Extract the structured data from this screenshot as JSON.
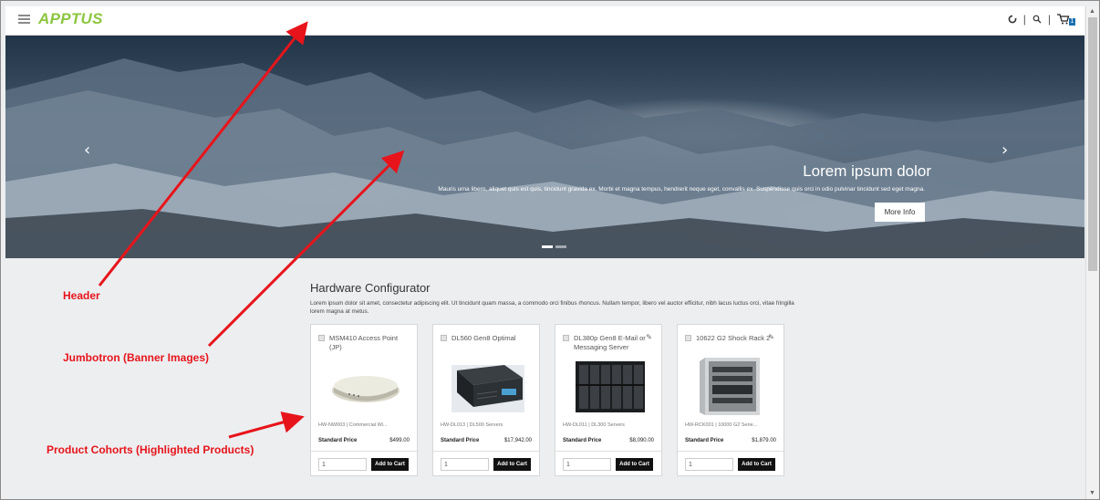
{
  "header": {
    "logo": "APPTUS",
    "icons": [
      "refresh-icon",
      "search-icon",
      "cart-icon"
    ],
    "cart_count": "1",
    "separator": "|"
  },
  "jumbotron": {
    "title": "Lorem ipsum dolor",
    "text": "Mauris urna libero, aliquet quis est quis, tincidunt gravida ex. Morbi et magna tempus, hendrerit neque eget, convallis ex. Suspendisse quis orci in odio pulvinar tincidunt sed eget magna.",
    "button": "More Info",
    "prev": "‹",
    "next": "›"
  },
  "configurator": {
    "title": "Hardware Configurator",
    "description": "Lorem ipsum dolor sit amet, consectetur adipiscing elit. Ut tincidunt quam massa, a commodo orci finibus rhoncus. Nullam tempor, libero vel auctor efficitur, nibh lacus luctus orci, vitae fringilla lorem magna at metus."
  },
  "products": [
    {
      "name": "MSM410 Access Point (JP)",
      "code": "HW-NW003",
      "category": "Commercial Wi...",
      "price_label": "Standard Price",
      "price": "$499.00",
      "qty": "1",
      "button": "Add to Cart",
      "pinned": false
    },
    {
      "name": "DL560 Gen8 Optimal",
      "code": "HW-DL013",
      "category": "DL500 Servers",
      "price_label": "Standard Price",
      "price": "$17,942.00",
      "qty": "1",
      "button": "Add to Cart",
      "pinned": false
    },
    {
      "name": "DL380p Gen8 E-Mail or Messaging Server",
      "code": "HW-DL011",
      "category": "DL300 Servers",
      "price_label": "Standard Price",
      "price": "$8,090.00",
      "qty": "1",
      "button": "Add to Cart",
      "pinned": true
    },
    {
      "name": "10622 G2 Shock Rack 2",
      "code": "HW-RCK001",
      "category": "10000 G2 Serie...",
      "price_label": "Standard Price",
      "price": "$1,879.00",
      "qty": "1",
      "button": "Add to Cart",
      "pinned": true
    }
  ],
  "annotations": {
    "header": "Header",
    "jumbotron": "Jumbotron (Banner Images)",
    "cohorts": "Product Cohorts (Highlighted Products)"
  },
  "colors": {
    "brand": "#8cc63f",
    "annotation": "#e8141b",
    "button": "#111111",
    "badge": "#1a6fb0"
  }
}
